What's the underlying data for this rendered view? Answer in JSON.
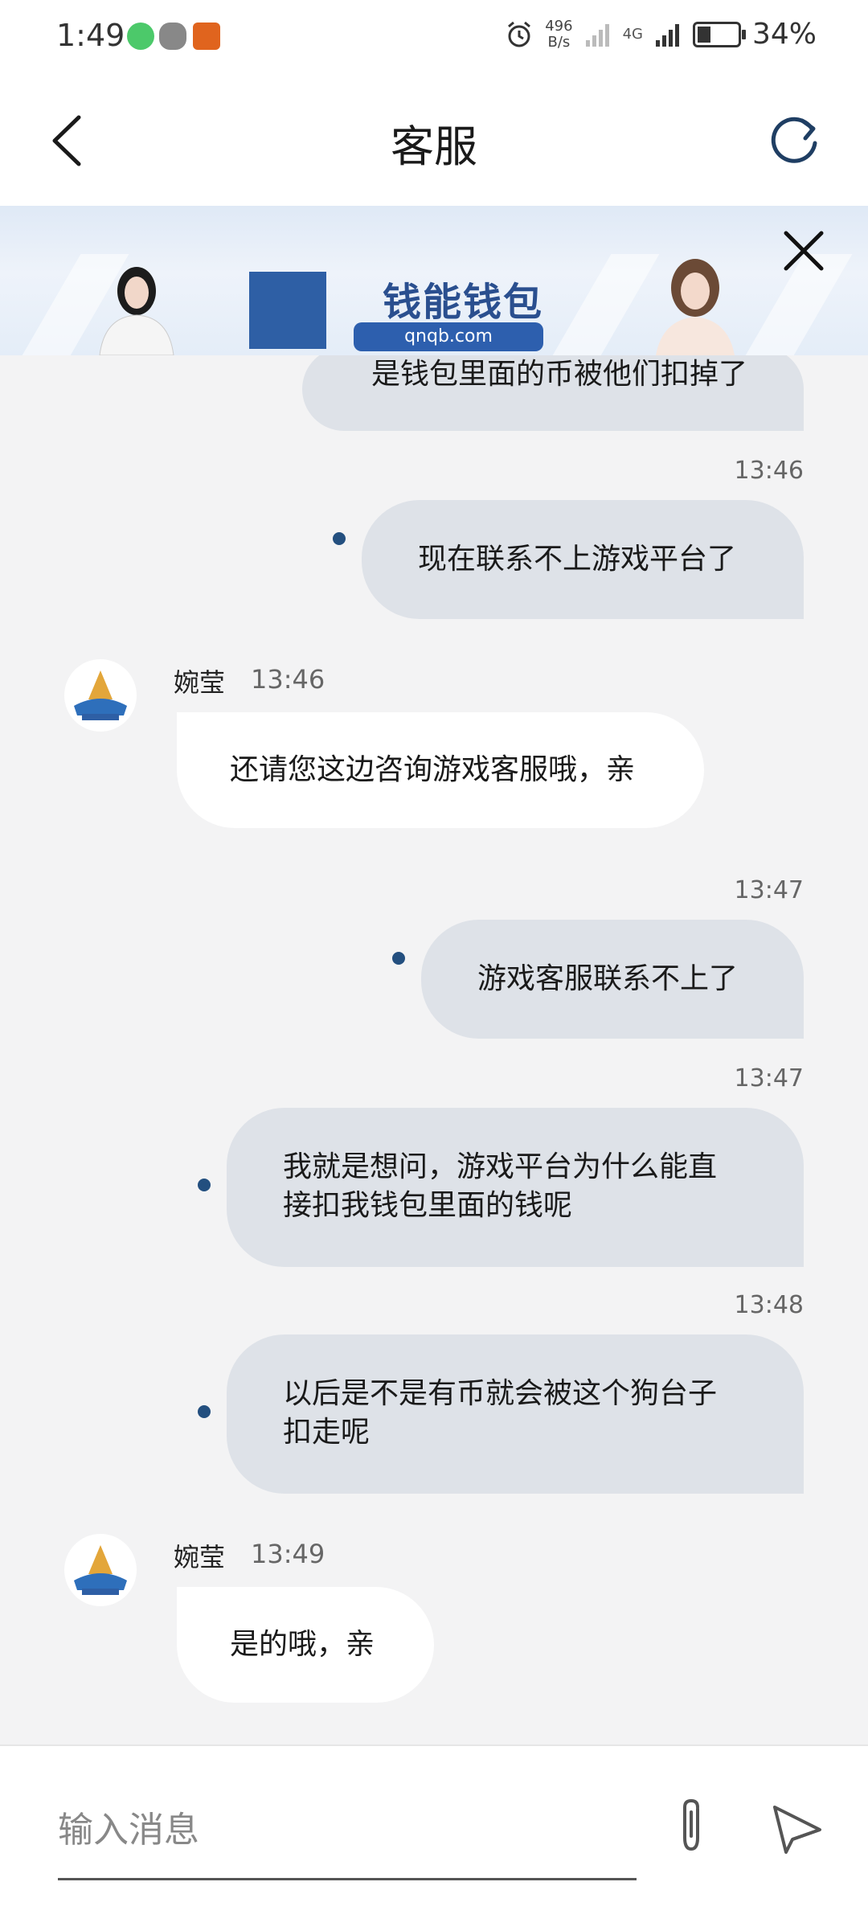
{
  "status_bar": {
    "time": "1:49",
    "net_speed_value": "496",
    "net_speed_unit": "B/s",
    "signal_label": "4G",
    "battery": "34%",
    "battery_level": 0.34
  },
  "header": {
    "title": "客服"
  },
  "ad": {
    "brand": "钱能钱包",
    "url": "qnqb.com"
  },
  "chat": {
    "partial_message": "是钱包里面的币被他们扣掉了",
    "messages": [
      {
        "time": "13:46",
        "text": "现在联系不上游戏平台了"
      },
      {
        "agent": "婉莹",
        "time": "13:46",
        "text": "还请您这边咨询游戏客服哦，亲"
      },
      {
        "time": "13:47",
        "text": "游戏客服联系不上了"
      },
      {
        "time": "13:47",
        "line1": "我就是想问，游戏平台为什么能直",
        "line2": "接扣我钱包里面的钱呢"
      },
      {
        "time": "13:48",
        "line1": "以后是不是有币就会被这个狗台子",
        "line2": "扣走呢"
      },
      {
        "agent": "婉莹",
        "time": "13:49",
        "text": "是的哦，亲"
      }
    ]
  },
  "input": {
    "placeholder": "输入消息",
    "value": ""
  },
  "colors": {
    "outgoing_bubble": "#dee2e8",
    "incoming_bubble": "#ffffff",
    "chat_background": "#f3f3f4",
    "status_dot": "#234f7f",
    "ad_brand": "#2d5fae"
  }
}
